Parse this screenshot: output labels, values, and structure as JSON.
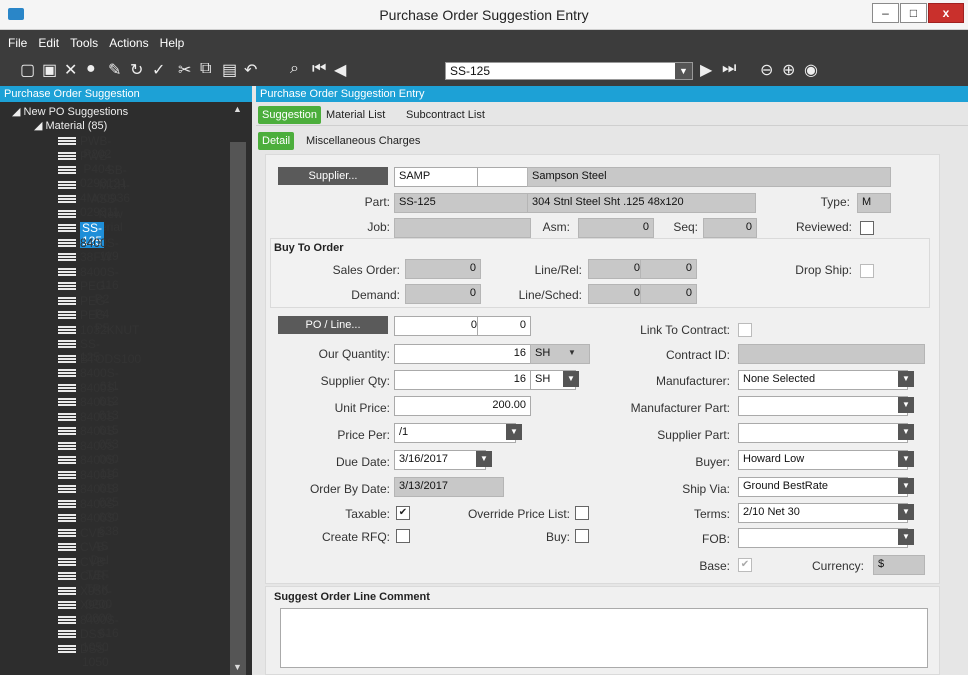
{
  "window": {
    "title": "Purchase Order Suggestion Entry",
    "min": "–",
    "max": "□",
    "close": "x"
  },
  "menu": [
    "File",
    "Edit",
    "Tools",
    "Actions",
    "Help"
  ],
  "toolbar": {
    "nav_value": "SS-125"
  },
  "left": {
    "header": "Purchase Order Suggestion",
    "root": "New PO Suggestions",
    "group": "Material (85)",
    "items": [
      "PWB-P202",
      "PWB-P404",
      "SB-0293121",
      "MCH-4M00936",
      "ASS-029311",
      "New Material",
      "SS-125",
      "8400S-119",
      "38FW",
      "8400S-116",
      "PEG-P2",
      "PEG-P4",
      "PEG-P5",
      "1032KNUT",
      "SS-125",
      "BTODS100",
      "8400S-611",
      "8400S-612",
      "8400S-613",
      "8400S-615",
      "8400S-053",
      "8400S-060",
      "8400S-116",
      "8400S-618",
      "8400S-625",
      "8400S-630",
      "8400S-638",
      "CVB-AS",
      "CVB-Del",
      "CVB-TEF",
      "CVR-TRK",
      "X950-0200",
      "X950-0600",
      "8400S-616",
      "DSS-1050",
      "DSS-1050"
    ],
    "selected_index": 6
  },
  "right": {
    "header": "Purchase Order Suggestion Entry",
    "tabs1": [
      "Suggestion",
      "Material List",
      "Subcontract List"
    ],
    "tabs2": [
      "Detail",
      "Miscellaneous Charges"
    ]
  },
  "form": {
    "supplier_btn": "Supplier...",
    "supplier_id": "SAMP",
    "supplier_name": "Sampson Steel",
    "part_label": "Part:",
    "part": "SS-125",
    "part_desc": "304 Stnl Steel Sht .125 48x120",
    "type_label": "Type:",
    "type": "M",
    "job_label": "Job:",
    "asm_label": "Asm:",
    "asm": "0",
    "seq_label": "Seq:",
    "seq": "0",
    "reviewed_label": "Reviewed:",
    "buy_to_order": "Buy To Order",
    "sales_order_label": "Sales Order:",
    "sales_order": "0",
    "linerel_label": "Line/Rel:",
    "line": "0",
    "rel": "0",
    "dropship_label": "Drop Ship:",
    "demand_label": "Demand:",
    "demand": "0",
    "linesched_label": "Line/Sched:",
    "sched_line": "0",
    "sched": "0",
    "poline_btn": "PO / Line...",
    "po": "0",
    "poline": "0",
    "link_contract_label": "Link To Contract:",
    "our_qty_label": "Our Quantity:",
    "our_qty": "16",
    "our_uom": "SH",
    "contract_id_label": "Contract ID:",
    "supplier_qty_label": "Supplier Qty:",
    "supplier_qty": "16",
    "supplier_uom": "SH",
    "manufacturer_label": "Manufacturer:",
    "manufacturer": "None Selected",
    "unit_price_label": "Unit Price:",
    "unit_price": "200.00",
    "mfg_part_label": "Manufacturer Part:",
    "price_per_label": "Price Per:",
    "price_per": "/1",
    "supplier_part_label": "Supplier Part:",
    "due_date_label": "Due Date:",
    "due_date": "3/16/2017",
    "buyer_label": "Buyer:",
    "buyer": "Howard Low",
    "order_by_label": "Order By Date:",
    "order_by": "3/13/2017",
    "ship_via_label": "Ship Via:",
    "ship_via": "Ground BestRate",
    "taxable_label": "Taxable:",
    "override_label": "Override Price List:",
    "terms_label": "Terms:",
    "terms": "2/10 Net 30",
    "rfq_label": "Create RFQ:",
    "buy_label": "Buy:",
    "fob_label": "FOB:",
    "base_label": "Base:",
    "currency_label": "Currency:",
    "currency": "$",
    "comment_heading": "Suggest Order Line Comment"
  }
}
